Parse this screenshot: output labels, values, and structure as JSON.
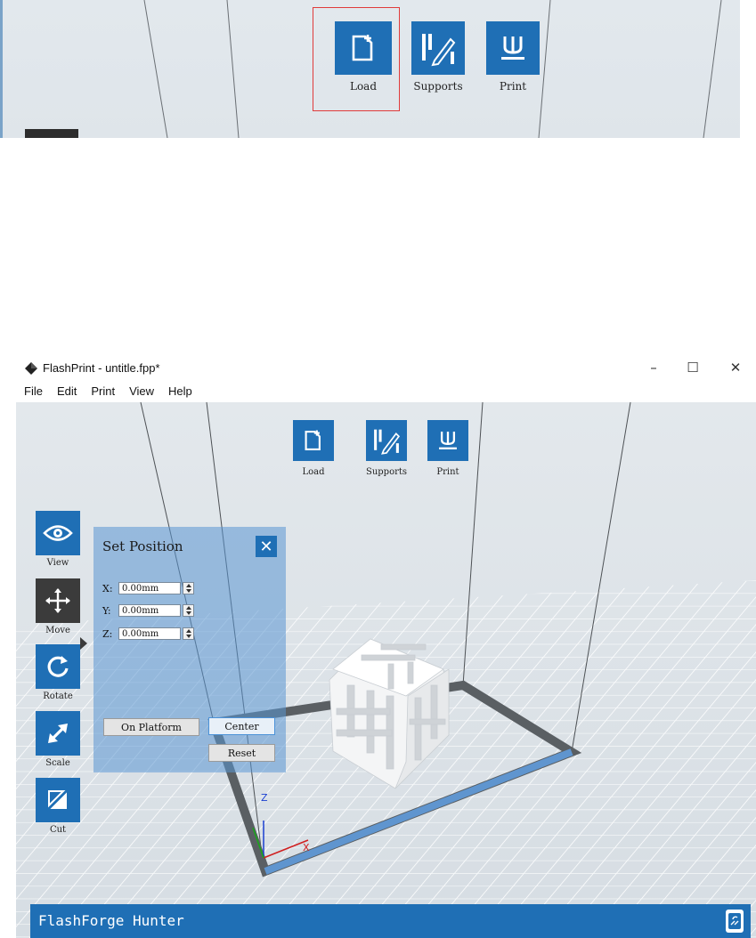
{
  "top_toolbar": {
    "load_label": "Load",
    "supports_label": "Supports",
    "print_label": "Print"
  },
  "window": {
    "title": "FlashPrint - untitle.fpp*",
    "controls": {
      "minimize": "–",
      "maximize": "☐",
      "close": "✕"
    }
  },
  "menu": {
    "items": [
      "File",
      "Edit",
      "Print",
      "View",
      "Help"
    ]
  },
  "toolbar": {
    "load_label": "Load",
    "supports_label": "Supports",
    "print_label": "Print"
  },
  "side_tools": {
    "view_label": "View",
    "move_label": "Move",
    "rotate_label": "Rotate",
    "scale_label": "Scale",
    "cut_label": "Cut",
    "active": "Move"
  },
  "set_position": {
    "title": "Set Position",
    "x_label": "X:",
    "x_value": "0.00mm",
    "y_label": "Y:",
    "y_value": "0.00mm",
    "z_label": "Z:",
    "z_value": "0.00mm",
    "on_platform_label": "On Platform",
    "center_label": "Center",
    "reset_label": "Reset"
  },
  "axis_labels": {
    "z": "Z",
    "x": "X"
  },
  "status": {
    "printer_name": "FlashForge Hunter"
  },
  "colors": {
    "accent_blue": "#1f6fb5",
    "active_tool": "#3b3b3b",
    "highlight_red": "#e03b3b",
    "viewport_bg": "#e3e8ec"
  }
}
